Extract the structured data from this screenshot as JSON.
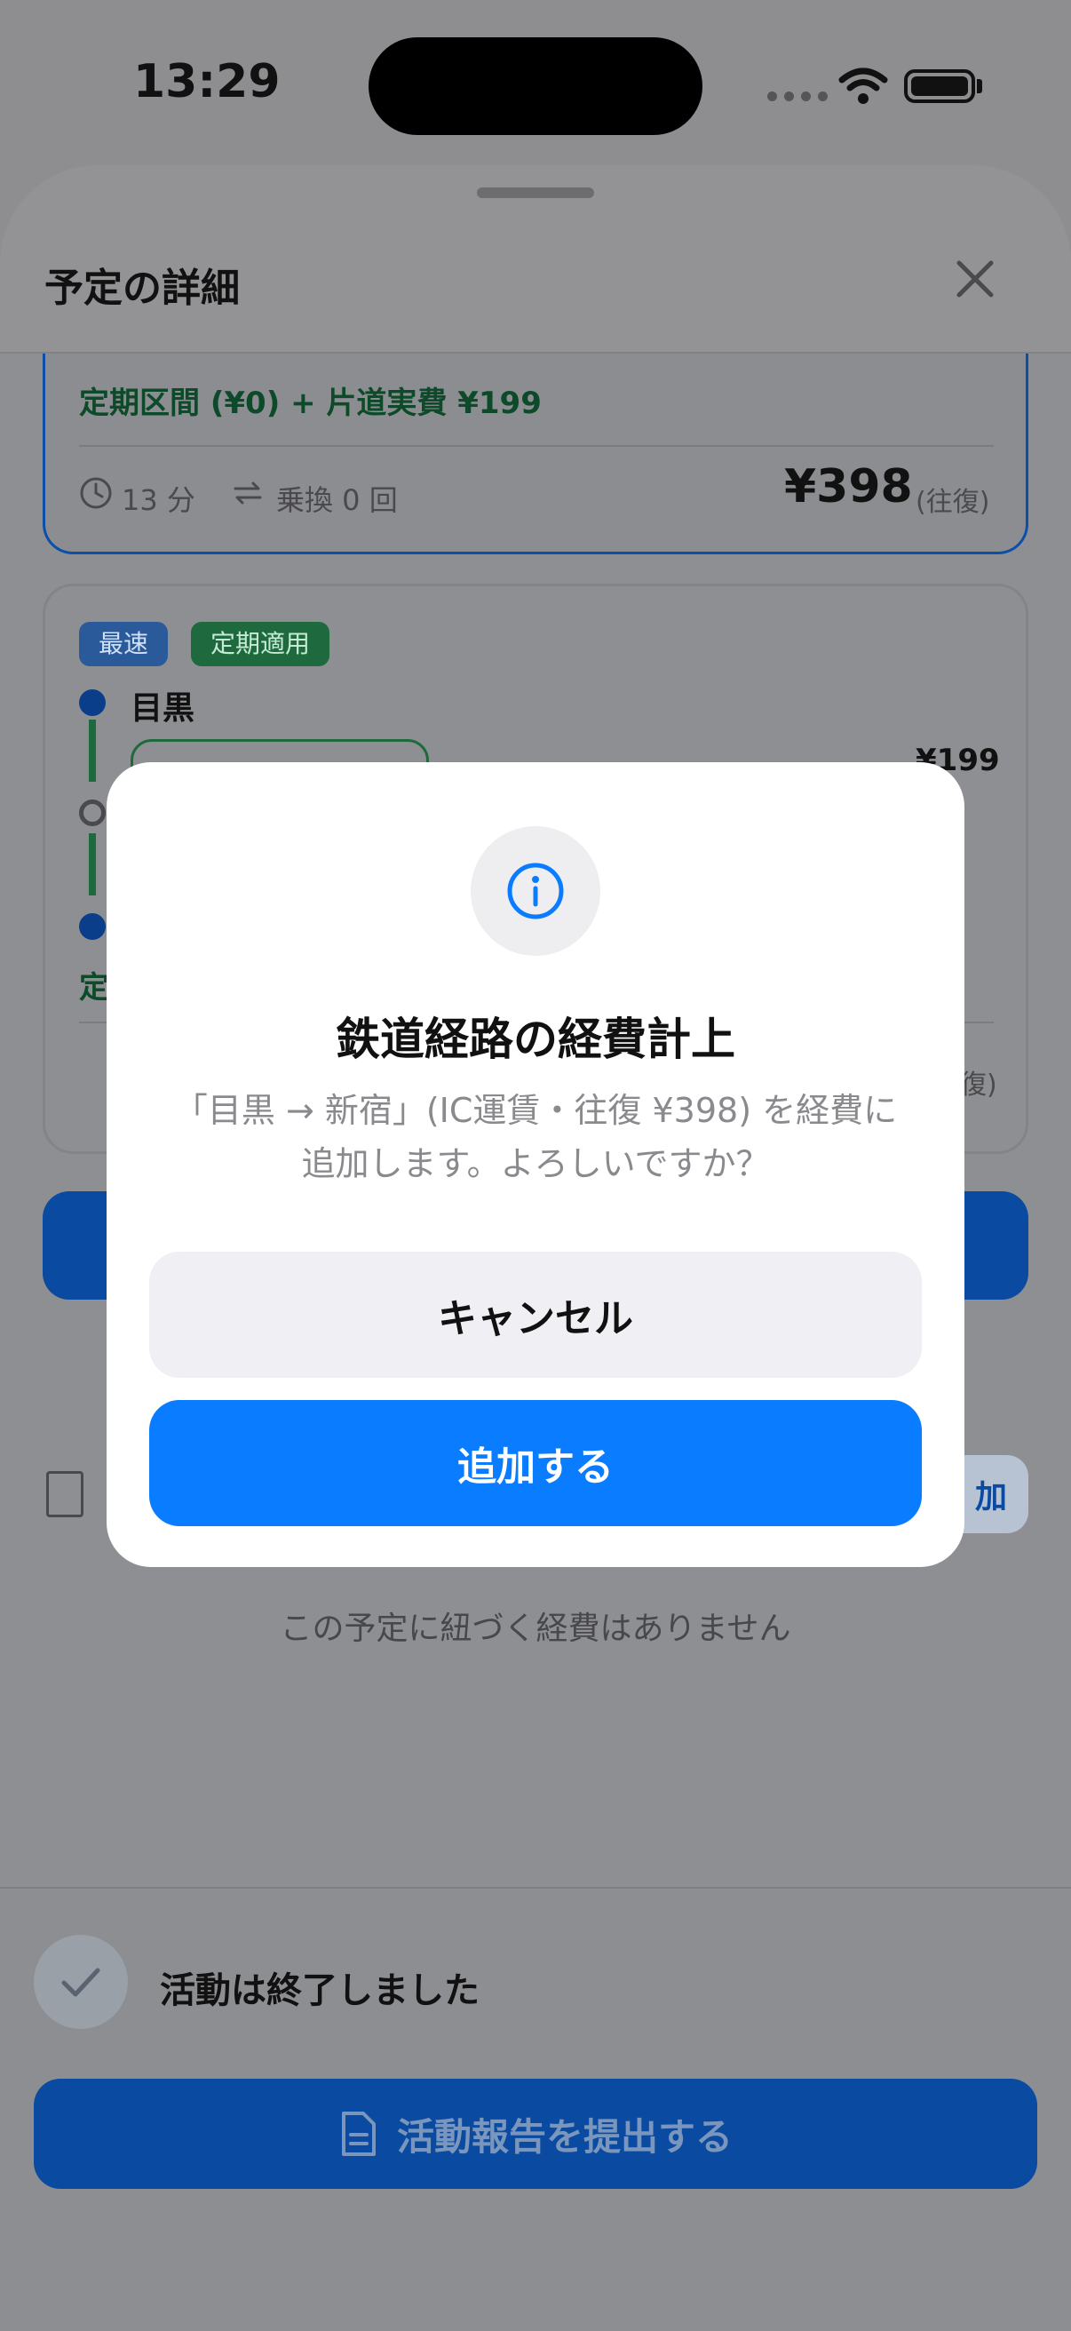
{
  "status_bar": {
    "time": "13:29"
  },
  "sheet": {
    "title": "予定の詳細",
    "close_icon": "close-icon"
  },
  "route_card_1": {
    "fare_note": "定期区間 (¥0) + 片道実費 ¥199",
    "duration": "13 分",
    "transfers": "乗換 0 回",
    "price": "¥398",
    "price_suffix": "(往復)"
  },
  "route_card_2": {
    "badges": [
      "最速",
      "定期適用"
    ],
    "origin": "目黒",
    "segment_price": "¥199",
    "partial_suffix": "復)",
    "partial_label": "定"
  },
  "expenses": {
    "add_label": "加",
    "empty_text": "この予定に紐づく経費はありません"
  },
  "bottom": {
    "done_text": "活動は終了しました",
    "report_button": "活動報告を提出する"
  },
  "modal": {
    "icon": "info-icon",
    "title": "鉄道経路の経費計上",
    "message": "「目黒 → 新宿」(IC運賃・往復 ¥398) を経費に追加します。よろしいですか？",
    "cancel_label": "キャンセル",
    "confirm_label": "追加する"
  },
  "colors": {
    "accent": "#0A7CFF",
    "overlay": "#8E8F92",
    "pass_green": "#1E6A3E"
  }
}
